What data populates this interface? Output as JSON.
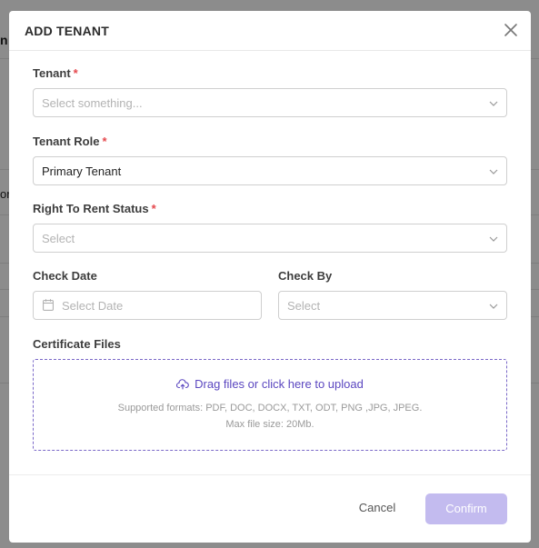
{
  "background": {
    "fragments": [
      "n",
      "ore"
    ]
  },
  "modal": {
    "title": "ADD TENANT",
    "fields": {
      "tenant": {
        "label": "Tenant",
        "required_mark": "*",
        "placeholder": "Select something..."
      },
      "tenant_role": {
        "label": "Tenant Role",
        "required_mark": "*",
        "value": "Primary Tenant"
      },
      "right_to_rent": {
        "label": "Right To Rent Status",
        "required_mark": "*",
        "placeholder": "Select"
      },
      "check_date": {
        "label": "Check Date",
        "placeholder": "Select Date"
      },
      "check_by": {
        "label": "Check By",
        "placeholder": "Select"
      },
      "certificate_files": {
        "label": "Certificate Files",
        "upload_text": "Drag files or click here to upload",
        "supported_formats": "Supported formats: PDF, DOC, DOCX, TXT, ODT, PNG ,JPG, JPEG.",
        "max_size": "Max file size: 20Mb."
      }
    },
    "buttons": {
      "cancel": "Cancel",
      "confirm": "Confirm"
    },
    "icons": {
      "close": "close-icon",
      "chevron": "chevron-down-icon",
      "calendar": "calendar-icon",
      "upload": "cloud-upload-icon"
    },
    "colors": {
      "accent": "#5b47c0",
      "confirm_disabled": "#c3bbef",
      "required": "#e5484d"
    }
  }
}
